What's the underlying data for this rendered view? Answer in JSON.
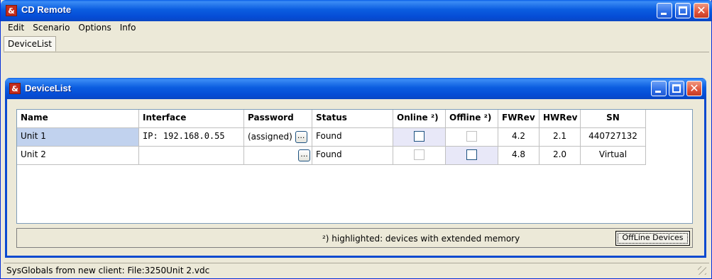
{
  "app": {
    "title": "CD Remote",
    "icon": "&",
    "accent": "#0a5fe8"
  },
  "menu": [
    {
      "label": "Edit"
    },
    {
      "label": "Scenario"
    },
    {
      "label": "Options"
    },
    {
      "label": "Info"
    }
  ],
  "tabs": [
    {
      "label": "DeviceList"
    }
  ],
  "inner_window": {
    "title": "DeviceList",
    "icon": "&"
  },
  "table": {
    "columns": [
      "Name",
      "Interface",
      "Password",
      "Status",
      "Online ²)",
      "Offline ²)",
      "FWRev",
      "HWRev",
      "SN"
    ],
    "rows": [
      {
        "name": "Unit 1",
        "interface": "IP: 192.168.0.55",
        "password": "(assigned)",
        "status": "Found",
        "online_checked": false,
        "offline_checked": false,
        "fwrev": "4.2",
        "hwrev": "2.1",
        "sn": "440727132"
      },
      {
        "name": "Unit 2",
        "interface": "",
        "password": "",
        "status": "Found",
        "online_checked": false,
        "offline_checked": false,
        "fwrev": "4.8",
        "hwrev": "2.0",
        "sn": "Virtual"
      }
    ],
    "password_button": "..."
  },
  "footer": {
    "note": "²) highlighted: devices with extended memory",
    "offline_button": "OffLine Devices"
  },
  "status": "SysGlobals from new client: File:3250Unit 2.vdc",
  "icons": {
    "minimize": "minimize-icon",
    "maximize": "maximize-icon",
    "close": "close-icon"
  }
}
